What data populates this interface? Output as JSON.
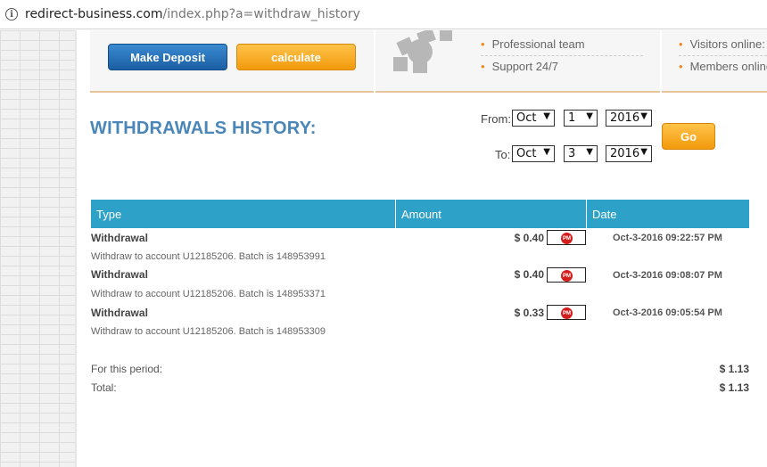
{
  "browser": {
    "url_host": "redirect-business.com",
    "url_path": "/index.php?a=withdraw_history"
  },
  "panel": {
    "deposit_label": "Make Deposit",
    "calculate_label": "calculate",
    "features": [
      "Professional team",
      "Support 24/7"
    ],
    "stats": [
      "Visitors online:",
      "Members online"
    ]
  },
  "page": {
    "title": "WITHDRAWALS HISTORY:"
  },
  "filter": {
    "from_label": "From:",
    "to_label": "To:",
    "from_month": "Oct",
    "from_day": "1",
    "from_year": "2016",
    "to_month": "Oct",
    "to_day": "3",
    "to_year": "2016",
    "go_label": "Go"
  },
  "table": {
    "headers": [
      "Type",
      "Amount",
      "Date"
    ],
    "rows": [
      {
        "type": "Withdrawal",
        "amount": "$ 0.40",
        "badge": "PM",
        "date": "Oct-3-2016 09:22:57 PM",
        "desc": "Withdraw to account U12185206. Batch is 148953991"
      },
      {
        "type": "Withdrawal",
        "amount": "$ 0.40",
        "badge": "PM",
        "date": "Oct-3-2016 09:08:07 PM",
        "desc": "Withdraw to account U12185206. Batch is 148953371"
      },
      {
        "type": "Withdrawal",
        "amount": "$ 0.33",
        "badge": "PM",
        "date": "Oct-3-2016 09:05:54 PM",
        "desc": "Withdraw to account U12185206. Batch is 148953309"
      }
    ]
  },
  "summary": {
    "period_label": "For this period:",
    "period_value": "$ 1.13",
    "total_label": "Total:",
    "total_value": "$ 1.13"
  },
  "colors": {
    "header_bg": "#2ea1c9",
    "title": "#4a86b8",
    "accent_orange": "#f29a0c",
    "deposit_blue": "#1b5fa3"
  },
  "icons": [
    "info-icon",
    "gear-icon",
    "perfect-money-icon",
    "bullet-icon",
    "dropdown-arrow-icon"
  ]
}
